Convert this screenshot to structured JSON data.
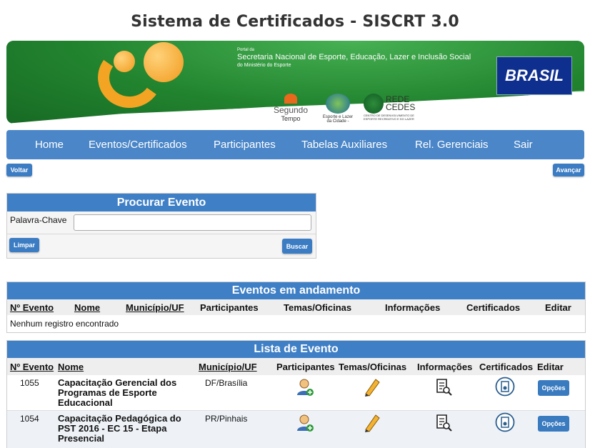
{
  "app": {
    "title": "Sistema de Certificados - SISCRT 3.0"
  },
  "banner": {
    "portal": "Portal da",
    "org_name": "Secretaria Nacional de Esporte, Educação, Lazer e Inclusão Social",
    "org_sub": "do Ministério do Esporte",
    "brasil_logo": "BRASIL",
    "partner_1_line1": "Segundo",
    "partner_1_line2": "Tempo",
    "partner_2": "Esporte e Lazer da Cidade - PELC",
    "partner_3_line1": "REDE",
    "partner_3_line2": "CEDES",
    "partner_3_sub": "CENTRO DE DESENVOLVIMENTO DE ESPORTE RECREATIVO E DO LAZER"
  },
  "nav": {
    "items": [
      "Home",
      "Eventos/Certificados",
      "Participantes",
      "Tabelas Auxiliares",
      "Rel. Gerenciais",
      "Sair"
    ]
  },
  "toolbar": {
    "back": "Voltar",
    "next": "Avançar"
  },
  "search": {
    "title": "Procurar Evento",
    "label": "Palavra-Chave",
    "value": "",
    "clear": "Limpar",
    "submit": "Buscar"
  },
  "ongoing": {
    "title": "Eventos em andamento",
    "headers": [
      "Nº Evento",
      "Nome",
      "Município/UF",
      "Participantes",
      "Temas/Oficinas",
      "Informações",
      "Certificados",
      "Editar"
    ],
    "empty": "Nenhum registro encontrado"
  },
  "list": {
    "title": "Lista de Evento",
    "headers": [
      "Nº Evento",
      "Nome",
      "Município/UF",
      "Participantes",
      "Temas/Oficinas",
      "Informações",
      "Certificados",
      "Editar"
    ],
    "rows": [
      {
        "num": "1055",
        "name": "Capacitação Gerencial dos Programas de Esporte Educacional",
        "city": "DF/Brasília",
        "action": "Opções"
      },
      {
        "num": "1054",
        "name": "Capacitação Pedagógica do PST 2016 - EC 15 - Etapa Presencial",
        "city": "PR/Pinhais",
        "action": "Opções"
      }
    ]
  },
  "icons": {
    "participants": "user-add-icon",
    "topics": "pencil-icon",
    "info": "document-search-icon",
    "certificate": "certificate-icon"
  },
  "colors": {
    "accent": "#3f7fc6",
    "nav": "#4a86c8",
    "banner_green": "#2f9a3c"
  }
}
